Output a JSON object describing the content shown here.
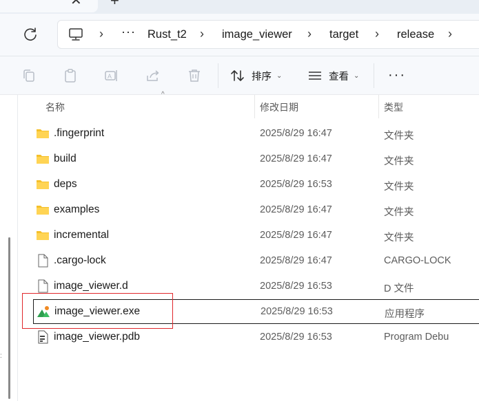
{
  "tabs": {
    "close_glyph": "✕",
    "new_glyph": "+"
  },
  "address_bar": {
    "overflow": "···",
    "crumbs": [
      "Rust_t2",
      "image_viewer",
      "target",
      "release"
    ],
    "separator": "›"
  },
  "command_bar": {
    "copy_icon": "copy-icon",
    "paste_icon": "clipboard-icon",
    "rename_icon": "rename-icon",
    "share_icon": "share-icon",
    "delete_icon": "trash-icon",
    "sort_label": "排序",
    "view_label": "查看",
    "more_label": "···"
  },
  "columns": {
    "name": "名称",
    "modified": "修改日期",
    "type": "类型"
  },
  "files": [
    {
      "name": ".fingerprint",
      "date": "2025/8/29 16:47",
      "type": "文件夹",
      "icon": "folder-icon"
    },
    {
      "name": "build",
      "date": "2025/8/29 16:47",
      "type": "文件夹",
      "icon": "folder-icon"
    },
    {
      "name": "deps",
      "date": "2025/8/29 16:53",
      "type": "文件夹",
      "icon": "folder-icon"
    },
    {
      "name": "examples",
      "date": "2025/8/29 16:47",
      "type": "文件夹",
      "icon": "folder-icon"
    },
    {
      "name": "incremental",
      "date": "2025/8/29 16:47",
      "type": "文件夹",
      "icon": "folder-icon"
    },
    {
      "name": ".cargo-lock",
      "date": "2025/8/29 16:47",
      "type": "CARGO-LOCK",
      "icon": "file-icon"
    },
    {
      "name": "image_viewer.d",
      "date": "2025/8/29 16:53",
      "type": "D 文件",
      "icon": "file-icon"
    },
    {
      "name": "image_viewer.exe",
      "date": "2025/8/29 16:53",
      "type": "应用程序",
      "icon": "app-icon"
    },
    {
      "name": "image_viewer.pdb",
      "date": "2025/8/29 16:53",
      "type": "Program Debu",
      "icon": "pdb-file-icon"
    }
  ],
  "colors": {
    "folder": "#f5c02a",
    "highlight": "#e0262a",
    "app_green": "#2e9e4f",
    "app_orange": "#f08a24"
  }
}
